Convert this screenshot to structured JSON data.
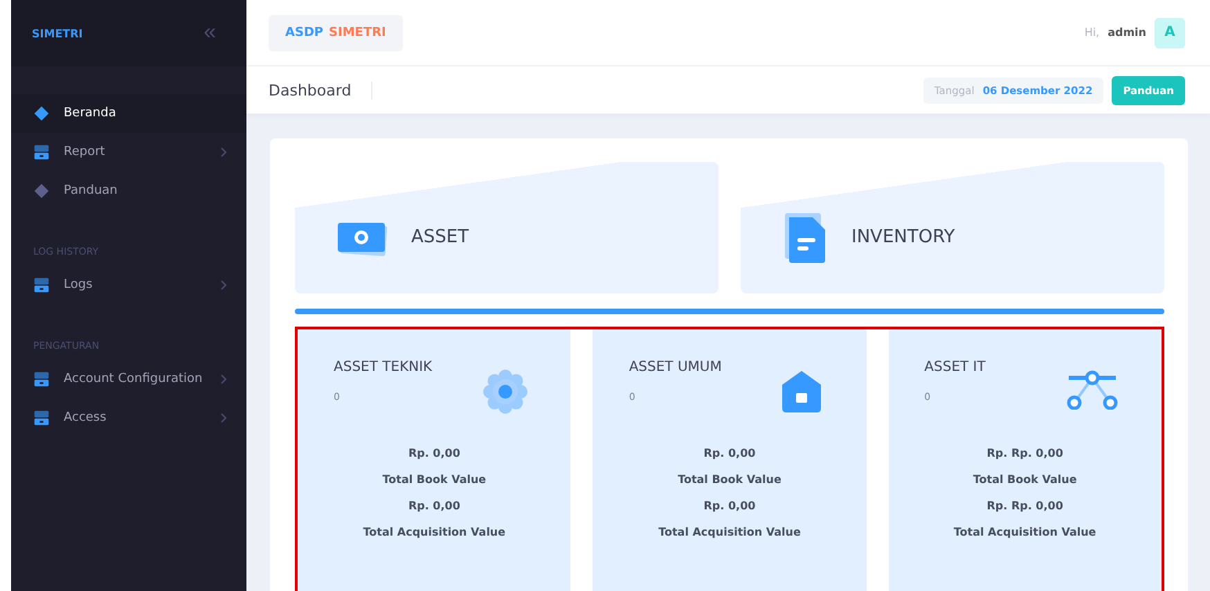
{
  "sidebar": {
    "brand": "SIMETRI",
    "collapse_icon": "«",
    "sections": [
      {
        "items": [
          {
            "label": "Beranda",
            "kind": "diamond",
            "selected": true,
            "has_submenu": false
          },
          {
            "label": "Report",
            "kind": "drawer",
            "selected": false,
            "has_submenu": true
          },
          {
            "label": "Panduan",
            "kind": "diamond",
            "selected": false,
            "has_submenu": false
          }
        ]
      },
      {
        "heading": "LOG HISTORY",
        "items": [
          {
            "label": "Logs",
            "kind": "drawer",
            "selected": false,
            "has_submenu": true
          }
        ]
      },
      {
        "heading": "PENGATURAN",
        "items": [
          {
            "label": "Account Configuration",
            "kind": "drawer",
            "selected": false,
            "has_submenu": true
          },
          {
            "label": "Access",
            "kind": "drawer",
            "selected": false,
            "has_submenu": true
          }
        ]
      }
    ]
  },
  "header": {
    "logo_part_1": "ASDP",
    "logo_part_2": "SIMETRI",
    "greeting": "Hi,",
    "user": "admin",
    "avatar": "A"
  },
  "subheader": {
    "title": "Dashboard",
    "date_label": "Tanggal",
    "date": "06 Desember 2022",
    "button": "Panduan"
  },
  "modules": [
    {
      "label": "ASSET",
      "kind": "camera"
    },
    {
      "label": "INVENTORY",
      "kind": "document"
    }
  ],
  "categories": {
    "highlighted": true,
    "items": [
      {
        "title": "ASSET TEKNIK",
        "count": "0",
        "kind": "gear",
        "book_value": "Rp. 0,00",
        "book_label": "Total Book Value",
        "acq_value": "Rp. 0,00",
        "acq_label": "Total Acquisition Value"
      },
      {
        "title": "ASSET UMUM",
        "count": "0",
        "kind": "house",
        "book_value": "Rp. 0,00",
        "book_label": "Total Book Value",
        "acq_value": "Rp. 0,00",
        "acq_label": "Total Acquisition Value"
      },
      {
        "title": "ASSET IT",
        "count": "0",
        "kind": "network",
        "book_value": "Rp. Rp. 0,00",
        "book_label": "Total Book Value",
        "acq_value": "Rp. Rp. 0,00",
        "acq_label": "Total Acquisition Value"
      }
    ]
  }
}
